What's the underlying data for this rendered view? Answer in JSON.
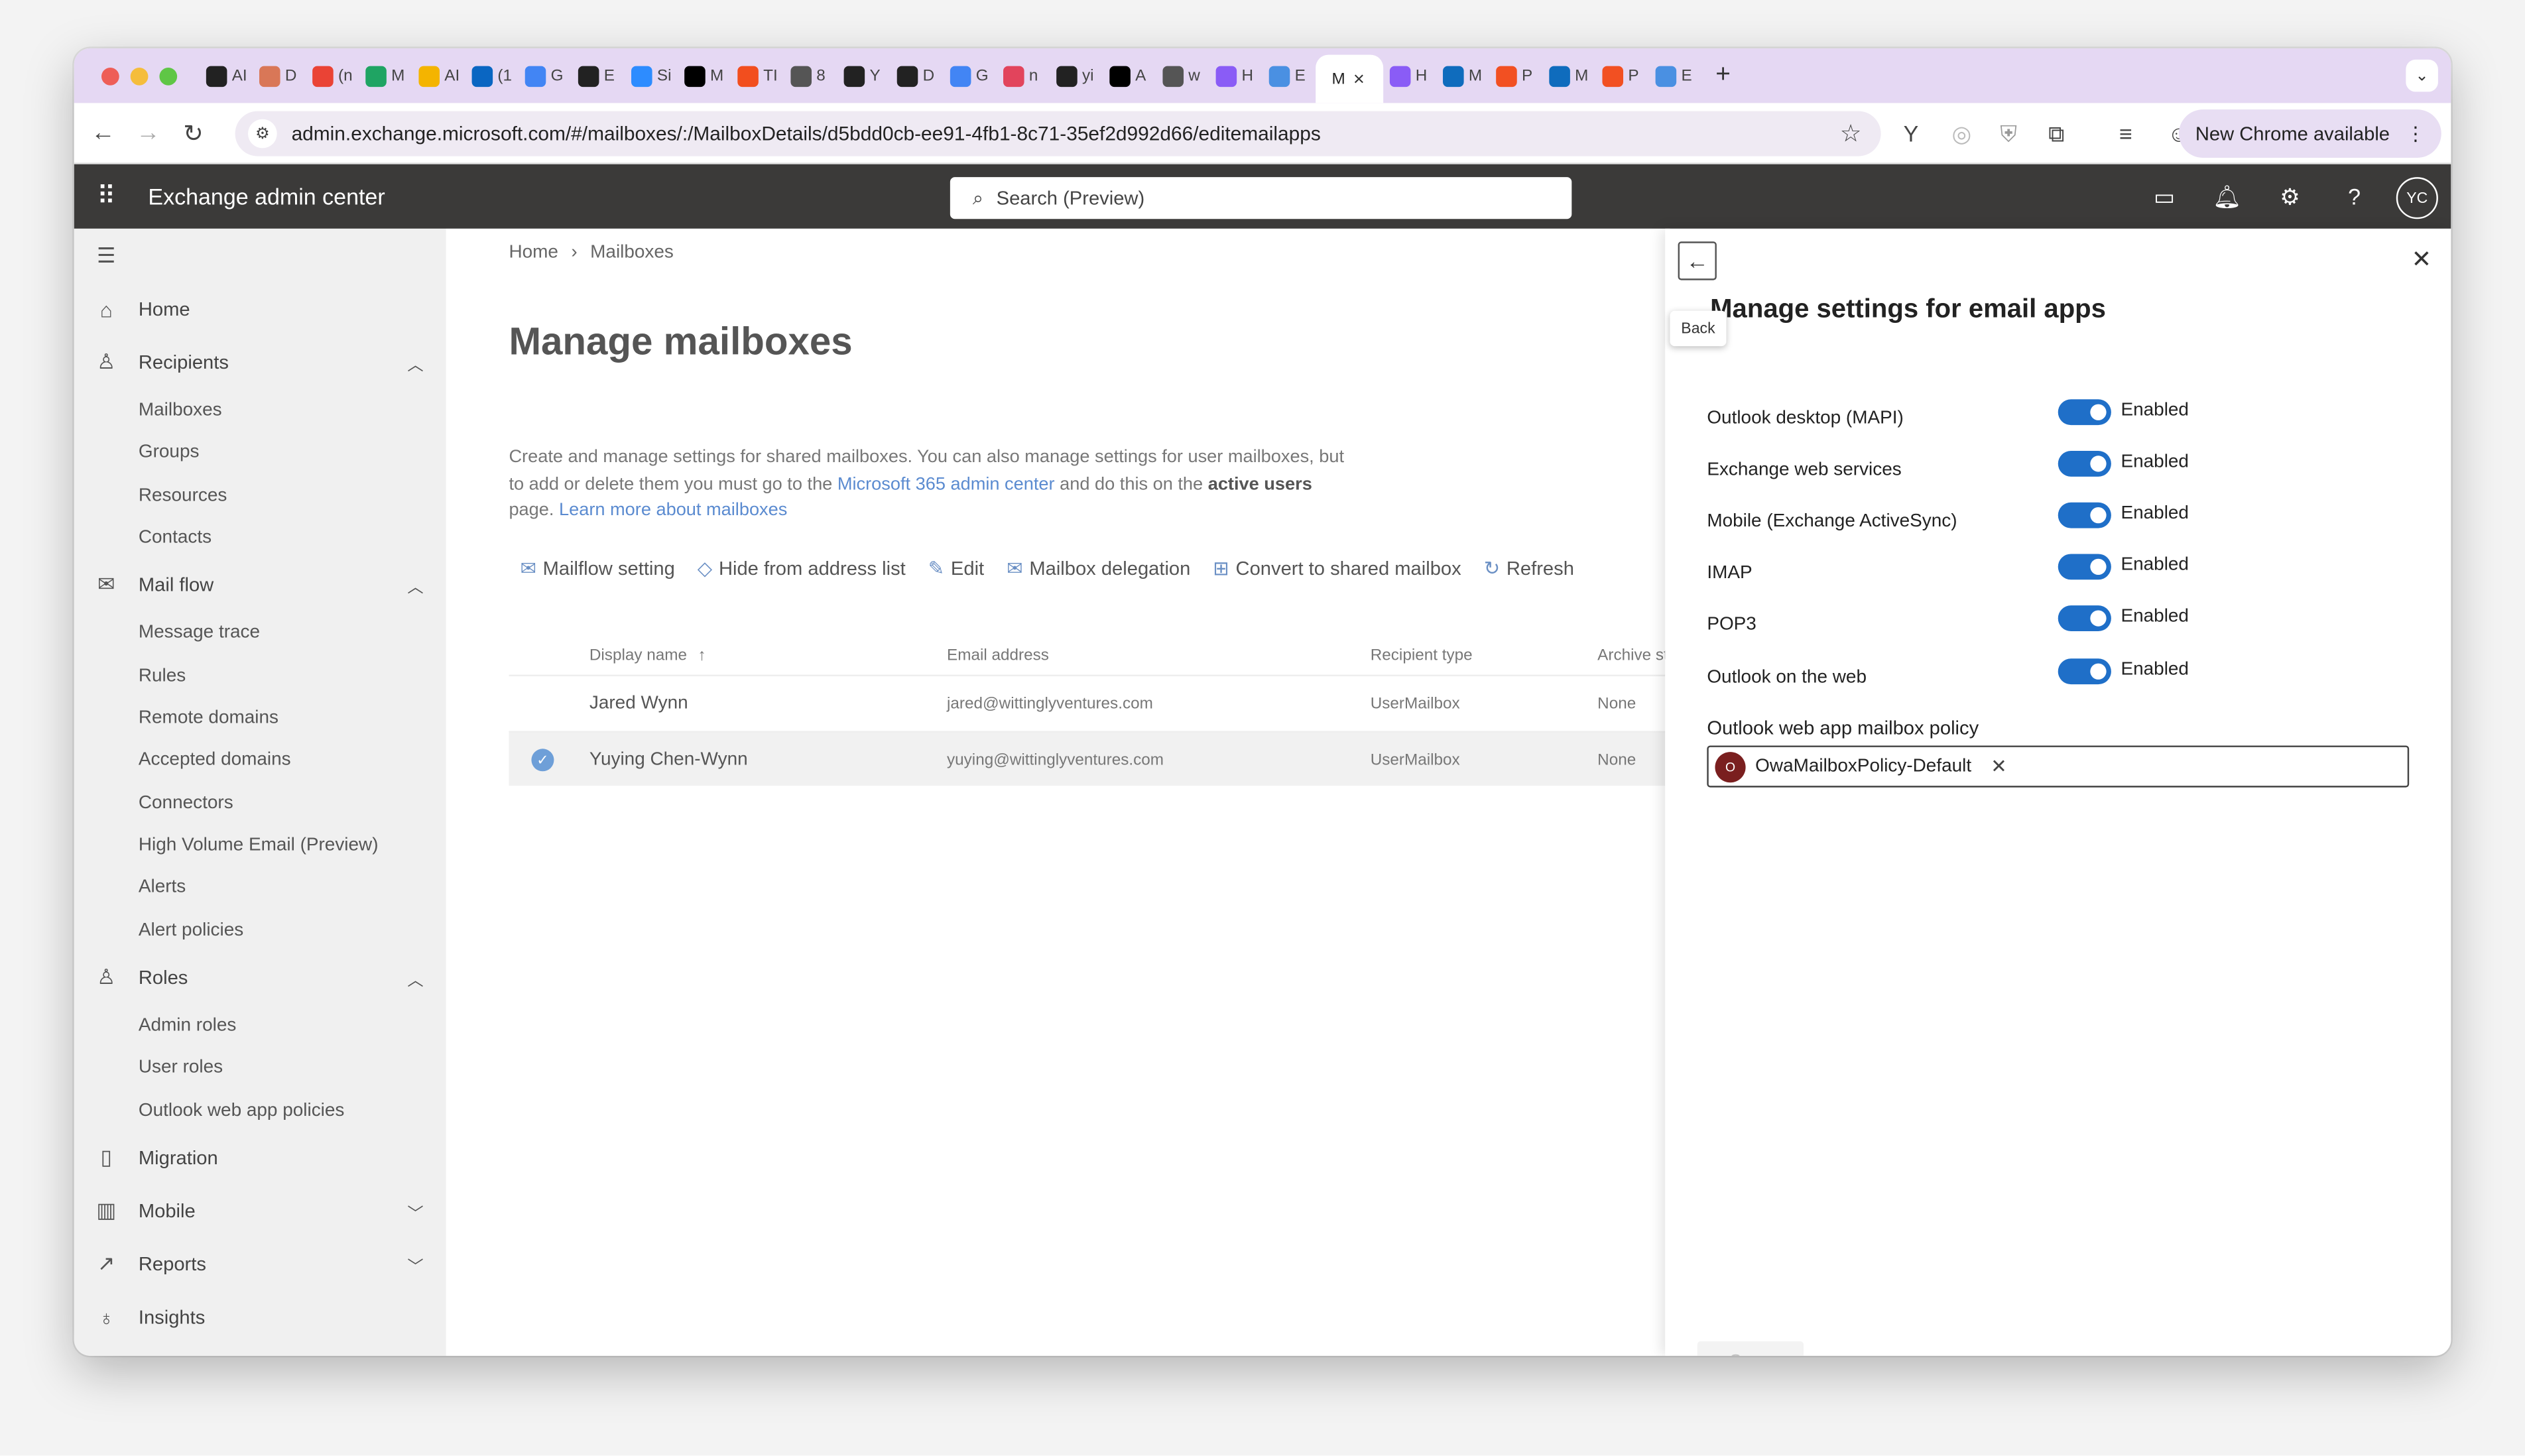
{
  "browser": {
    "tabs": [
      {
        "label": "AI",
        "icon": "openai-icon",
        "color": "#222222"
      },
      {
        "label": "D",
        "icon": "claude-icon",
        "color": "#d97757"
      },
      {
        "label": "(n",
        "icon": "gmail-icon",
        "color": "#ea4335"
      },
      {
        "label": "M",
        "icon": "drive-icon",
        "color": "#1fa463"
      },
      {
        "label": "AI",
        "icon": "slides-icon",
        "color": "#f4b400"
      },
      {
        "label": "(1",
        "icon": "linkedin-icon",
        "color": "#0a66c2"
      },
      {
        "label": "G",
        "icon": "calendar-icon",
        "color": "#4285f4"
      },
      {
        "label": "E",
        "icon": "openai-icon",
        "color": "#222222"
      },
      {
        "label": "Si",
        "icon": "zoom-icon",
        "color": "#2d8cff"
      },
      {
        "label": "M",
        "icon": "x-icon",
        "color": "#000000"
      },
      {
        "label": "TI",
        "icon": "figma-icon",
        "color": "#f24e1e"
      },
      {
        "label": "8",
        "icon": "globe-icon",
        "color": "#555555"
      },
      {
        "label": "Y",
        "icon": "github-icon",
        "color": "#222222"
      },
      {
        "label": "D",
        "icon": "openai-icon",
        "color": "#222222"
      },
      {
        "label": "G",
        "icon": "gemini-icon",
        "color": "#4285f4"
      },
      {
        "label": "n",
        "icon": "app-icon",
        "color": "#e2445c"
      },
      {
        "label": "yi",
        "icon": "github-icon",
        "color": "#222222"
      },
      {
        "label": "A",
        "icon": "app-icon",
        "color": "#000000"
      },
      {
        "label": "w",
        "icon": "globe-icon",
        "color": "#555555"
      },
      {
        "label": "H",
        "icon": "copilot-icon",
        "color": "#8a5cf6"
      },
      {
        "label": "E",
        "icon": "exchange-icon",
        "color": "#4a90e2"
      }
    ],
    "active_tab": {
      "label": "M",
      "close": "×"
    },
    "tabs_after": [
      {
        "label": "H",
        "icon": "copilot-icon",
        "color": "#8a5cf6"
      },
      {
        "label": "M",
        "icon": "outlook-icon",
        "color": "#0f6cbd"
      },
      {
        "label": "P",
        "icon": "microsoft-icon",
        "color": "#f25022"
      },
      {
        "label": "M",
        "icon": "outlook-icon",
        "color": "#0f6cbd"
      },
      {
        "label": "P",
        "icon": "microsoft-icon",
        "color": "#f25022"
      },
      {
        "label": "E",
        "icon": "exchange-icon",
        "color": "#4a90e2"
      }
    ],
    "new_tab": "+",
    "url": "admin.exchange.microsoft.com/#/mailboxes/:/MailboxDetails/d5bdd0cb-ee91-4fb1-8c71-35ef2d992d66/editemailapps",
    "new_chrome_label": "New Chrome available"
  },
  "app_header": {
    "title": "Exchange admin center",
    "search_placeholder": "Search (Preview)",
    "avatar_initials": "YC"
  },
  "sidebar": {
    "sections": [
      {
        "label": "Home",
        "icon": "home-icon"
      },
      {
        "label": "Recipients",
        "icon": "person-icon"
      },
      {
        "label": "Mail flow",
        "icon": "mail-icon"
      },
      {
        "label": "Roles",
        "icon": "roles-icon"
      },
      {
        "label": "Migration",
        "icon": "migration-icon"
      },
      {
        "label": "Mobile",
        "icon": "mobile-icon"
      },
      {
        "label": "Reports",
        "icon": "reports-icon"
      },
      {
        "label": "Insights",
        "icon": "insights-icon"
      }
    ],
    "recipients_items": [
      "Mailboxes",
      "Groups",
      "Resources",
      "Contacts"
    ],
    "mailflow_items": [
      "Message trace",
      "Rules",
      "Remote domains",
      "Accepted domains",
      "Connectors",
      "High Volume Email (Preview)",
      "Alerts",
      "Alert policies"
    ],
    "roles_items": [
      "Admin roles",
      "User roles",
      "Outlook web app policies"
    ]
  },
  "main": {
    "breadcrumb": [
      "Home",
      "Mailboxes"
    ],
    "title": "Manage mailboxes",
    "description_1": "Create and manage settings for shared mailboxes. You can also manage settings for user mailboxes, but to add or delete them you must go to the ",
    "description_link_1": "Microsoft 365 admin center",
    "description_2": " and do this on the ",
    "description_bold": "active users",
    "description_3": " page. ",
    "description_link_2": "Learn more about mailboxes",
    "commands": [
      "Mailflow setting",
      "Hide from address list",
      "Edit",
      "Mailbox delegation",
      "Convert to shared mailbox",
      "Refresh"
    ],
    "columns": [
      "Display name",
      "Email address",
      "Recipient type",
      "Archive st"
    ],
    "sort_indicator": "↑",
    "rows": [
      {
        "name": "Jared Wynn",
        "email": "jared@wittinglyventures.com",
        "type": "UserMailbox",
        "archive": "None",
        "selected": false
      },
      {
        "name": "Yuying Chen-Wynn",
        "email": "yuying@wittinglyventures.com",
        "type": "UserMailbox",
        "archive": "None",
        "selected": true
      }
    ]
  },
  "panel": {
    "back_tooltip": "Back",
    "title": "Manage settings for email apps",
    "settings": [
      {
        "label": "Outlook desktop (MAPI)",
        "value": "Enabled"
      },
      {
        "label": "Exchange web services",
        "value": "Enabled"
      },
      {
        "label": "Mobile (Exchange ActiveSync)",
        "value": "Enabled"
      },
      {
        "label": "IMAP",
        "value": "Enabled"
      },
      {
        "label": "POP3",
        "value": "Enabled"
      },
      {
        "label": "Outlook on the web",
        "value": "Enabled"
      }
    ],
    "policy_label": "Outlook web app mailbox policy",
    "policy_chip_initial": "O",
    "policy_value": "OwaMailboxPolicy-Default",
    "save_label": "Save"
  }
}
